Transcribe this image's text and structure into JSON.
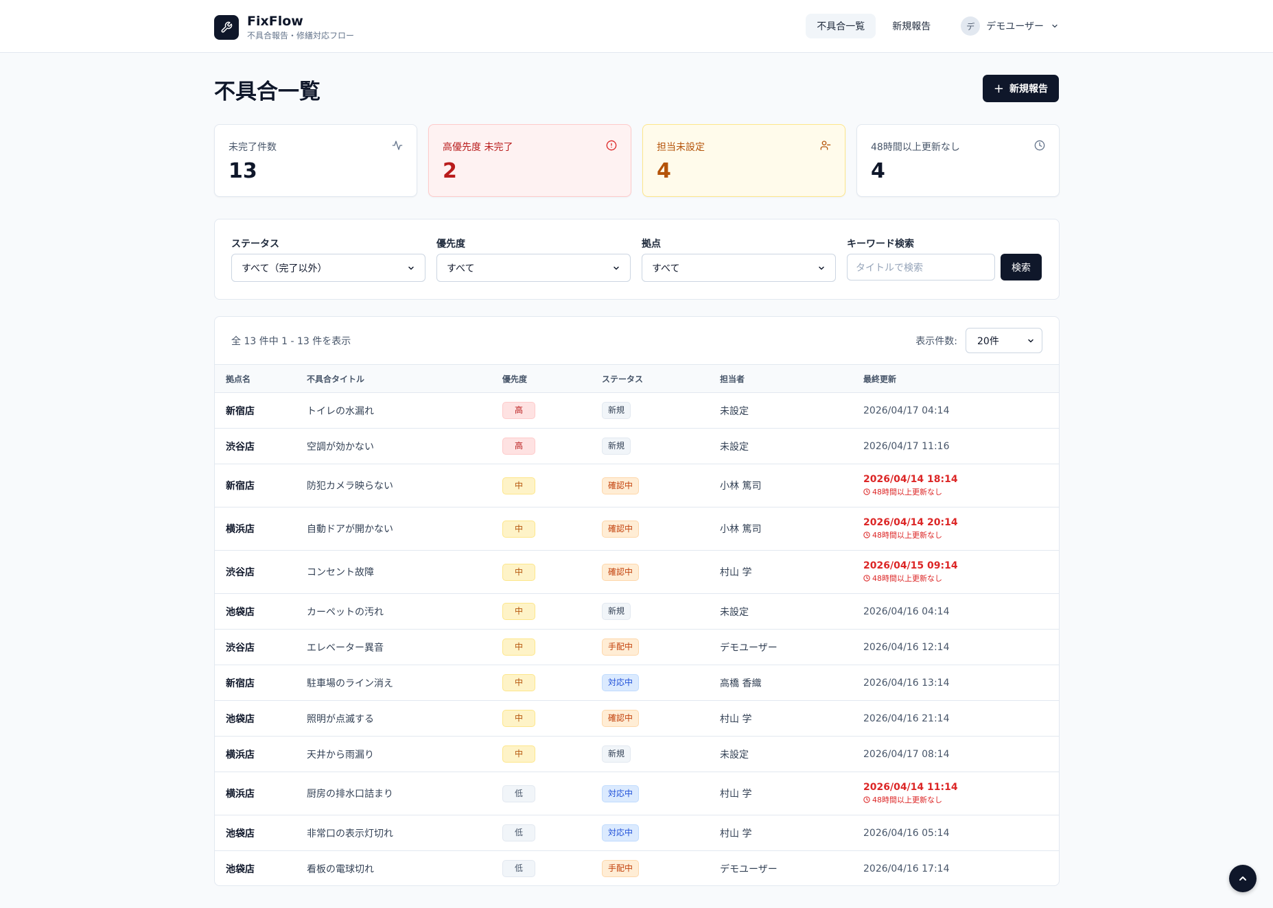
{
  "header": {
    "app_name": "FixFlow",
    "app_subtitle": "不具合報告・修繕対応フロー",
    "nav": [
      "不具合一覧",
      "新規報告"
    ],
    "user": {
      "initial": "デ",
      "name": "デモユーザー"
    }
  },
  "page": {
    "title": "不具合一覧",
    "new_button": "新規報告"
  },
  "stats": [
    {
      "label": "未完了件数",
      "value": "13",
      "icon": "activity-icon"
    },
    {
      "label": "高優先度 未完了",
      "value": "2",
      "icon": "alert-circle-icon"
    },
    {
      "label": "担当未設定",
      "value": "4",
      "icon": "user-minus-icon"
    },
    {
      "label": "48時間以上更新なし",
      "value": "4",
      "icon": "clock-icon"
    }
  ],
  "filters": {
    "status": {
      "label": "ステータス",
      "value": "すべて（完了以外）"
    },
    "priority": {
      "label": "優先度",
      "value": "すべて"
    },
    "site": {
      "label": "拠点",
      "value": "すべて"
    },
    "keyword": {
      "label": "キーワード検索",
      "placeholder": "タイトルで検索",
      "button": "検索"
    }
  },
  "table": {
    "count_text": "全 13 件中 1 - 13 件を表示",
    "per_page_label": "表示件数:",
    "per_page_value": "20件",
    "columns": [
      "拠点名",
      "不具合タイトル",
      "優先度",
      "ステータス",
      "担当者",
      "最終更新"
    ],
    "stale_note": "48時間以上更新なし",
    "rows": [
      {
        "site": "新宿店",
        "title": "トイレの水漏れ",
        "priority": "高",
        "status": "新規",
        "assignee": "未設定",
        "updated": "2026/04/17 04:14",
        "stale": false
      },
      {
        "site": "渋谷店",
        "title": "空調が効かない",
        "priority": "高",
        "status": "新規",
        "assignee": "未設定",
        "updated": "2026/04/17 11:16",
        "stale": false
      },
      {
        "site": "新宿店",
        "title": "防犯カメラ映らない",
        "priority": "中",
        "status": "確認中",
        "assignee": "小林 篤司",
        "updated": "2026/04/14 18:14",
        "stale": true
      },
      {
        "site": "横浜店",
        "title": "自動ドアが開かない",
        "priority": "中",
        "status": "確認中",
        "assignee": "小林 篤司",
        "updated": "2026/04/14 20:14",
        "stale": true
      },
      {
        "site": "渋谷店",
        "title": "コンセント故障",
        "priority": "中",
        "status": "確認中",
        "assignee": "村山 学",
        "updated": "2026/04/15 09:14",
        "stale": true
      },
      {
        "site": "池袋店",
        "title": "カーペットの汚れ",
        "priority": "中",
        "status": "新規",
        "assignee": "未設定",
        "updated": "2026/04/16 04:14",
        "stale": false
      },
      {
        "site": "渋谷店",
        "title": "エレベーター異音",
        "priority": "中",
        "status": "手配中",
        "assignee": "デモユーザー",
        "updated": "2026/04/16 12:14",
        "stale": false
      },
      {
        "site": "新宿店",
        "title": "駐車場のライン消え",
        "priority": "中",
        "status": "対応中",
        "assignee": "高橋 香織",
        "updated": "2026/04/16 13:14",
        "stale": false
      },
      {
        "site": "池袋店",
        "title": "照明が点滅する",
        "priority": "中",
        "status": "確認中",
        "assignee": "村山 学",
        "updated": "2026/04/16 21:14",
        "stale": false
      },
      {
        "site": "横浜店",
        "title": "天井から雨漏り",
        "priority": "中",
        "status": "新規",
        "assignee": "未設定",
        "updated": "2026/04/17 08:14",
        "stale": false
      },
      {
        "site": "横浜店",
        "title": "厨房の排水口詰まり",
        "priority": "低",
        "status": "対応中",
        "assignee": "村山 学",
        "updated": "2026/04/14 11:14",
        "stale": true
      },
      {
        "site": "池袋店",
        "title": "非常口の表示灯切れ",
        "priority": "低",
        "status": "対応中",
        "assignee": "村山 学",
        "updated": "2026/04/16 05:14",
        "stale": false
      },
      {
        "site": "池袋店",
        "title": "看板の電球切れ",
        "priority": "低",
        "status": "手配中",
        "assignee": "デモユーザー",
        "updated": "2026/04/16 17:14",
        "stale": false
      }
    ]
  },
  "colors": {
    "primary": "#0f172a",
    "danger": "#dc2626",
    "warning": "#b45309",
    "info": "#1d4ed8"
  }
}
